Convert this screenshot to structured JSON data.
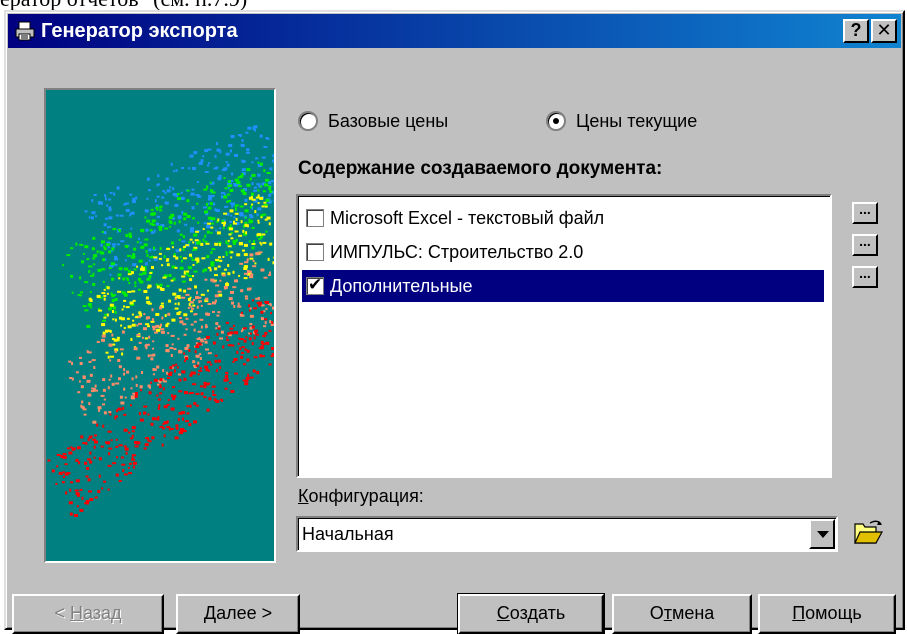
{
  "document_fragment": "ератор отчетов\" (см. п.7.9)",
  "window": {
    "title": "Генератор экспорта",
    "help_label": "?",
    "close_label": "✕"
  },
  "price_mode": {
    "options": [
      {
        "label": "Базовые цены",
        "checked": false
      },
      {
        "label": "Цены текущие",
        "checked": true
      }
    ]
  },
  "content": {
    "label": "Содержание создаваемого документа:",
    "items": [
      {
        "label": "Microsoft Excel - текстовый файл",
        "checked": false,
        "selected": false
      },
      {
        "label": "ИМПУЛЬС: Строительство 2.0",
        "checked": false,
        "selected": false
      },
      {
        "label": "Дополнительные",
        "checked": true,
        "selected": true
      }
    ],
    "settings_button_label": "..."
  },
  "configuration": {
    "label_first": "К",
    "label_rest": "онфигурация:",
    "value": "Начальная"
  },
  "buttons": {
    "back": {
      "prefix": "< ",
      "mnemonic": "Н",
      "rest": "азад"
    },
    "next": {
      "mnemonic": "Д",
      "rest": "алее >"
    },
    "create": {
      "mnemonic": "С",
      "rest": "оздать"
    },
    "cancel": {
      "prefix": "О",
      "mnemonic": "т",
      "rest": "мена"
    },
    "help": {
      "mnemonic": "П",
      "rest": "омощь"
    }
  },
  "colors": {
    "title_bar_start": "#000080",
    "title_bar_end": "#1084d0",
    "selection": "#000080",
    "art_background": "#008080"
  },
  "icons": {
    "title": "printer-icon",
    "folder": "open-folder-icon"
  }
}
